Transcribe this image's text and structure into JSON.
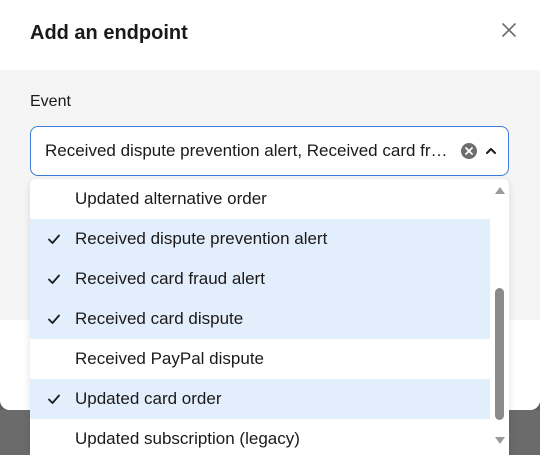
{
  "dialog": {
    "title": "Add an endpoint",
    "close_icon": "close-icon"
  },
  "event_field": {
    "label": "Event",
    "value": "Received dispute prevention alert, Received card fraud alert, Received card dispute, Updated card order",
    "clear_icon": "clear-circle-icon",
    "toggle_icon": "chevron-up-icon"
  },
  "dropdown": {
    "options": [
      {
        "label": "Updated alternative order",
        "selected": false
      },
      {
        "label": "Received dispute prevention alert",
        "selected": true
      },
      {
        "label": "Received card fraud alert",
        "selected": true
      },
      {
        "label": "Received card dispute",
        "selected": true
      },
      {
        "label": "Received PayPal dispute",
        "selected": false
      },
      {
        "label": "Updated card order",
        "selected": true
      },
      {
        "label": "Updated subscription (legacy)",
        "selected": false
      }
    ],
    "check_icon": "check-icon",
    "selected_color": "#e3eefc"
  },
  "colors": {
    "accent_border": "#3b7ddd",
    "scroll_thumb": "#8a8a8a"
  }
}
